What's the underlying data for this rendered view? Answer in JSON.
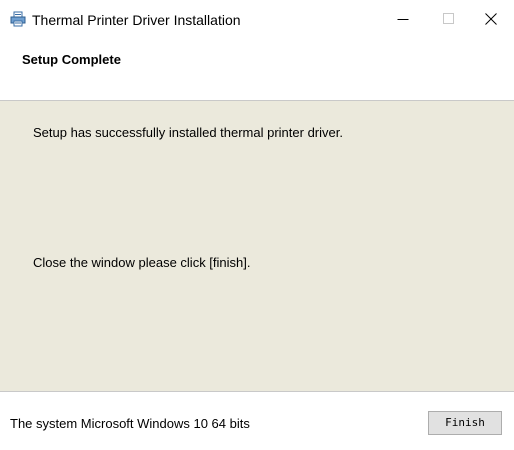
{
  "window": {
    "title": "Thermal Printer Driver Installation",
    "app_icon": "printer-icon",
    "controls": {
      "minimize": "minimize-icon",
      "maximize": "maximize-icon",
      "close": "close-icon"
    }
  },
  "header": {
    "title": "Setup Complete"
  },
  "content": {
    "success_message": "Setup has successfully installed thermal printer driver.",
    "close_instruction": "Close the window please click [finish]."
  },
  "footer": {
    "system_info": "The system Microsoft Windows 10 64 bits",
    "finish_label": "Finish"
  },
  "colors": {
    "content_background": "#ebe9dc",
    "separator": "#c9c9c9",
    "button_background": "#e1e1e1"
  }
}
